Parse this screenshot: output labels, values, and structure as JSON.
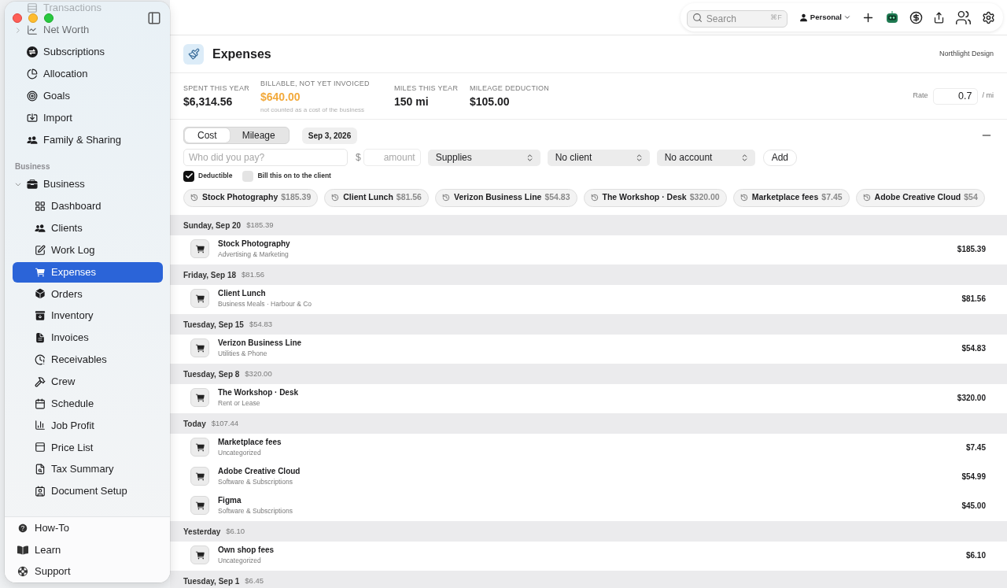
{
  "sidebar": {
    "items": [
      {
        "label": "Transactions",
        "selected": false
      },
      {
        "label": "Net Worth",
        "selected": false,
        "expanded": false
      },
      {
        "label": "Subscriptions",
        "selected": false
      },
      {
        "label": "Allocation",
        "selected": false
      },
      {
        "label": "Goals",
        "selected": false
      },
      {
        "label": "Import",
        "selected": false
      },
      {
        "label": "Family & Sharing",
        "selected": false
      }
    ],
    "sections": [
      {
        "label": "Business",
        "items": [
          {
            "label": "Business",
            "selected": false,
            "expanded": true,
            "children": [
              {
                "label": "Dashboard",
                "selected": false
              },
              {
                "label": "Clients",
                "selected": false
              },
              {
                "label": "Work Log",
                "selected": false
              },
              {
                "label": "Expenses",
                "selected": true
              },
              {
                "label": "Orders",
                "selected": false
              },
              {
                "label": "Inventory",
                "selected": false
              },
              {
                "label": "Invoices",
                "selected": false
              },
              {
                "label": "Receivables",
                "selected": false
              },
              {
                "label": "Crew",
                "selected": false
              },
              {
                "label": "Schedule",
                "selected": false
              },
              {
                "label": "Job Profit",
                "selected": false
              },
              {
                "label": "Price List",
                "selected": false
              },
              {
                "label": "Tax Summary",
                "selected": false
              },
              {
                "label": "Document Setup",
                "selected": false
              }
            ]
          }
        ]
      }
    ],
    "footer": [
      {
        "label": "How-To"
      },
      {
        "label": "Learn"
      },
      {
        "label": "Support"
      }
    ]
  },
  "toolbar": {
    "search": {
      "placeholder": "Search",
      "shortcut": "⌘F"
    },
    "profile": "Personal"
  },
  "header": {
    "title": "Expenses",
    "business": "Northlight Design"
  },
  "stats": [
    {
      "label": "SPENT THIS YEAR",
      "value": "$6,314.56",
      "kind": "plain"
    },
    {
      "label": "BILLABLE, NOT YET INVOICED",
      "value": "$640.00",
      "note": "not counted as a cost of the business",
      "kind": "highlight"
    },
    {
      "label": "MILES THIS YEAR",
      "value": "150 mi",
      "kind": "plain"
    },
    {
      "label": "MILEAGE DEDUCTION",
      "value": "$105.00",
      "kind": "plain"
    }
  ],
  "rate": {
    "label": "Rate",
    "value": "0.7",
    "unit": "/ mi"
  },
  "entry_form": {
    "modes": [
      {
        "label": "Cost",
        "selected": true
      },
      {
        "label": "Mileage",
        "selected": false
      }
    ],
    "date": "Sep 3, 2026",
    "payee": {
      "placeholder": "Who did you pay?"
    },
    "currency": "$",
    "amount": {
      "placeholder": "amount"
    },
    "selects": [
      {
        "value": "Supplies"
      },
      {
        "value": "No client"
      },
      {
        "value": "No account"
      }
    ],
    "add_button": "Add",
    "options": [
      {
        "label": "Deductible",
        "checked": true
      },
      {
        "label": "Bill this on to the client",
        "checked": false
      }
    ]
  },
  "recent": [
    {
      "name": "Stock Photography",
      "amount": "$185.39"
    },
    {
      "name": "Client Lunch",
      "amount": "$81.56"
    },
    {
      "name": "Verizon Business Line",
      "amount": "$54.83"
    },
    {
      "name": "The Workshop · Desk",
      "amount": "$320.00"
    },
    {
      "name": "Marketplace fees",
      "amount": "$7.45"
    },
    {
      "name": "Adobe Creative Cloud",
      "amount": "$54"
    }
  ],
  "days": [
    {
      "label": "Sunday, Sep 20",
      "total": "$185.39",
      "entries": [
        {
          "name": "Stock Photography",
          "category": "Advertising & Marketing",
          "amount": "$185.39"
        }
      ]
    },
    {
      "label": "Friday, Sep 18",
      "total": "$81.56",
      "entries": [
        {
          "name": "Client Lunch",
          "category": "Business Meals · Harbour & Co",
          "amount": "$81.56"
        }
      ]
    },
    {
      "label": "Tuesday, Sep 15",
      "total": "$54.83",
      "entries": [
        {
          "name": "Verizon Business Line",
          "category": "Utilities & Phone",
          "amount": "$54.83"
        }
      ]
    },
    {
      "label": "Tuesday, Sep 8",
      "total": "$320.00",
      "entries": [
        {
          "name": "The Workshop · Desk",
          "category": "Rent or Lease",
          "amount": "$320.00"
        }
      ]
    },
    {
      "label": "Today",
      "total": "$107.44",
      "entries": [
        {
          "name": "Marketplace fees",
          "category": "Uncategorized",
          "amount": "$7.45"
        },
        {
          "name": "Adobe Creative Cloud",
          "category": "Software & Subscriptions",
          "amount": "$54.99"
        },
        {
          "name": "Figma",
          "category": "Software & Subscriptions",
          "amount": "$45.00"
        }
      ]
    },
    {
      "label": "Yesterday",
      "total": "$6.10",
      "entries": [
        {
          "name": "Own shop fees",
          "category": "Uncategorized",
          "amount": "$6.10"
        }
      ]
    },
    {
      "label": "Tuesday, Sep 1",
      "total": "$6.45"
    }
  ]
}
